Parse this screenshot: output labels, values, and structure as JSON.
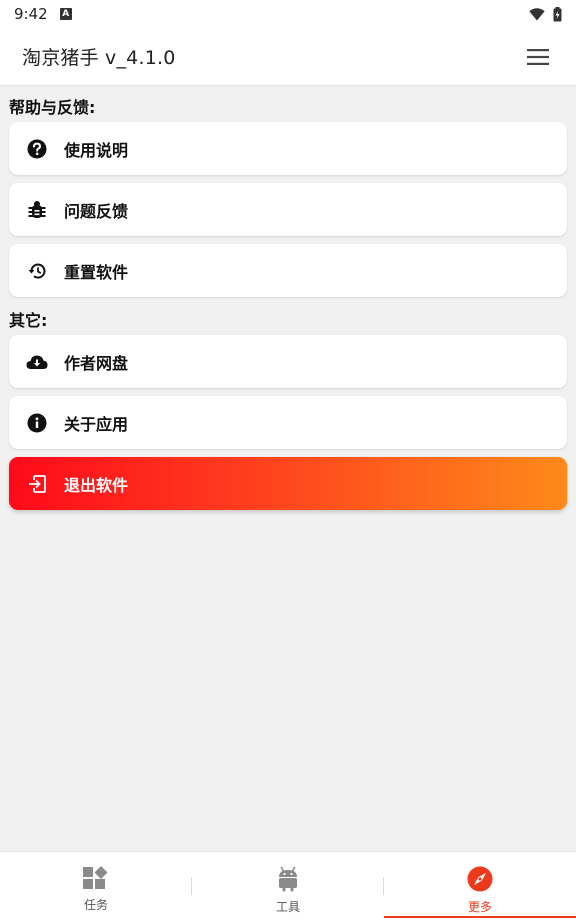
{
  "status_bar": {
    "time": "9:42",
    "a_glyph": "A"
  },
  "app_bar": {
    "title": "淘京猪手 v_4.1.0",
    "menu_icon": "hamburger-icon"
  },
  "sections": [
    {
      "title": "帮助与反馈:",
      "items": [
        {
          "label": "使用说明",
          "icon": "help-circle-icon"
        },
        {
          "label": "问题反馈",
          "icon": "bug-icon"
        },
        {
          "label": "重置软件",
          "icon": "restore-icon"
        }
      ]
    },
    {
      "title": "其它:",
      "items": [
        {
          "label": "作者网盘",
          "icon": "cloud-download-icon"
        },
        {
          "label": "关于应用",
          "icon": "info-icon"
        }
      ]
    }
  ],
  "exit_button": {
    "label": "退出软件",
    "icon": "exit-icon"
  },
  "bottom_nav": [
    {
      "label": "任务",
      "icon": "widgets-icon",
      "active": false
    },
    {
      "label": "工具",
      "icon": "android-icon",
      "active": false
    },
    {
      "label": "更多",
      "icon": "compass-icon",
      "active": true
    }
  ],
  "colors": {
    "accent": "#ee3a1c",
    "exit_gradient_start": "#ff0a1a",
    "exit_gradient_end": "#ff8a1a",
    "background": "#f1f1f1"
  }
}
